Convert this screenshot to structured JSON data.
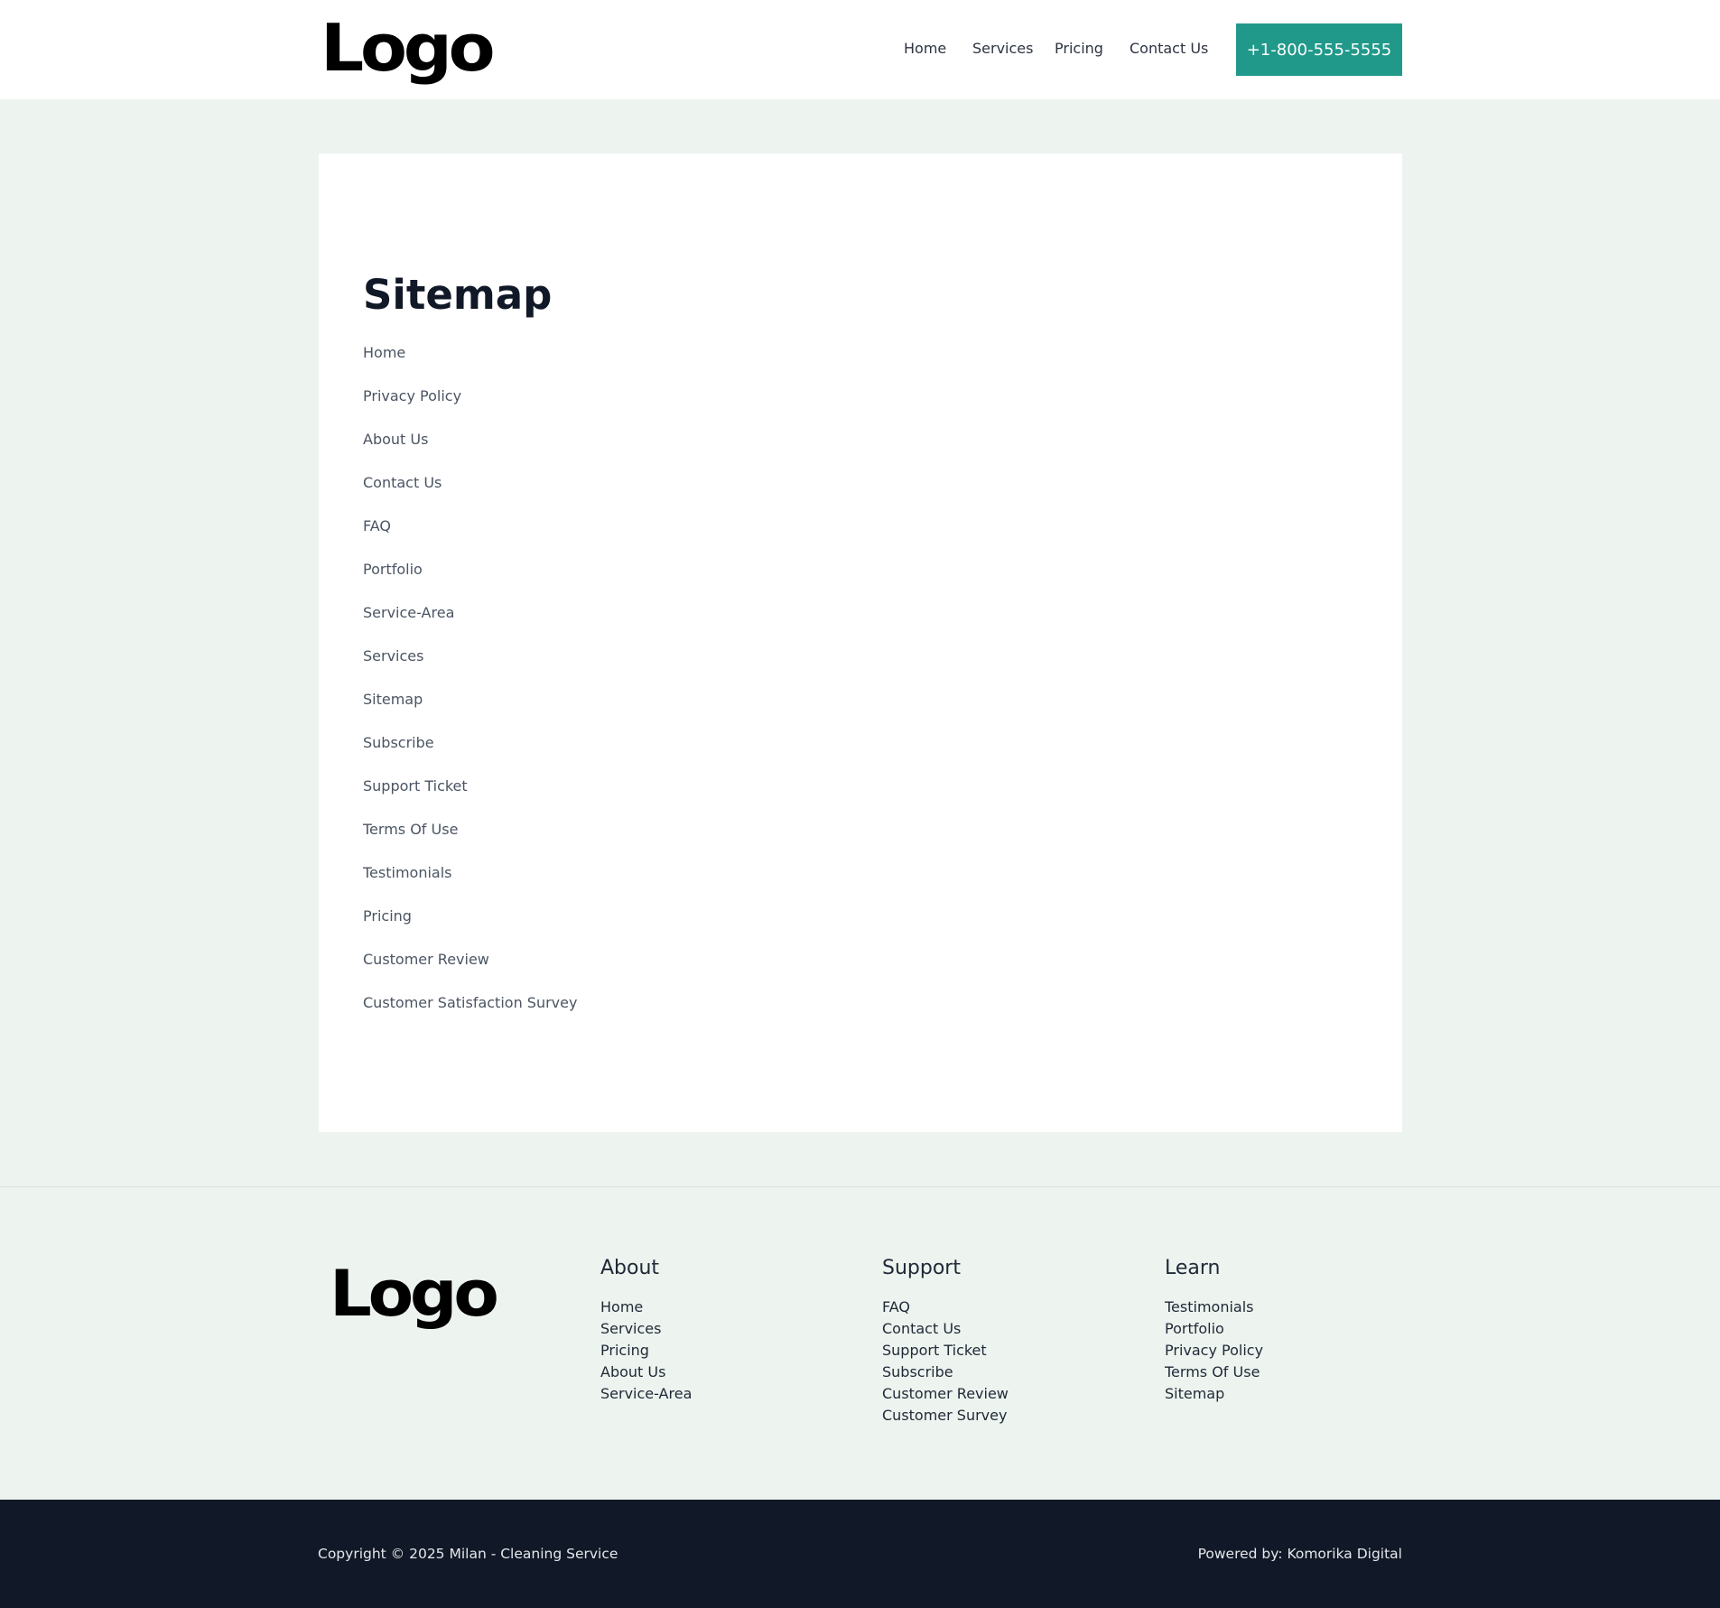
{
  "header": {
    "logo_text": "Logo",
    "nav": [
      {
        "label": "Home"
      },
      {
        "label": "Services"
      },
      {
        "label": "Pricing"
      },
      {
        "label": "Contact Us"
      }
    ],
    "phone_button": "+1-800-555-5555"
  },
  "main": {
    "title": "Sitemap",
    "links": [
      "Home",
      "Privacy Policy",
      "About Us",
      "Contact Us",
      "FAQ",
      "Portfolio",
      "Service-Area",
      "Services",
      "Sitemap",
      "Subscribe",
      "Support Ticket",
      "Terms Of Use",
      "Testimonials",
      "Pricing",
      "Customer Review",
      "Customer Satisfaction Survey"
    ]
  },
  "footer": {
    "logo_text": "Logo",
    "columns": [
      {
        "heading": "About",
        "links": [
          "Home",
          "Services",
          "Pricing",
          "About Us",
          "Service-Area"
        ]
      },
      {
        "heading": "Support",
        "links": [
          "FAQ",
          "Contact Us",
          "Support Ticket",
          "Subscribe",
          "Customer Review",
          "Customer Survey"
        ]
      },
      {
        "heading": "Learn",
        "links": [
          "Testimonials",
          "Portfolio",
          "Privacy Policy",
          "Terms Of Use",
          "Sitemap"
        ]
      }
    ],
    "copyright": "Copyright © 2025 Milan - Cleaning Service",
    "powered_by": "Powered by: Komorika Digital"
  },
  "colors": {
    "accent": "#21998a",
    "page_background": "#edf3ee",
    "bottom_bar": "#111827"
  }
}
